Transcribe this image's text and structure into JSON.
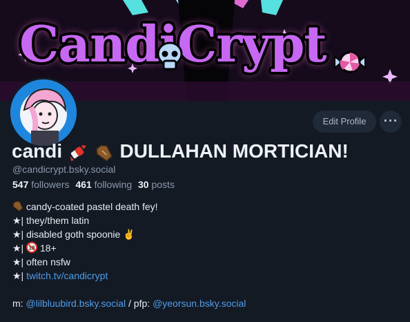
{
  "banner": {
    "title": "CandiCrypt"
  },
  "profile": {
    "display_name_prefix": "candi",
    "display_name_suffix": "DULLAHAN MORTICIAN!",
    "handle": "@candicrypt.bsky.social",
    "followers_count": "547",
    "followers_label": "followers",
    "following_count": "461",
    "following_label": "following",
    "posts_count": "30",
    "posts_label": "posts"
  },
  "buttons": {
    "edit_profile": "Edit Profile",
    "more": "···"
  },
  "bio": {
    "line1": "candy-coated pastel death fey!",
    "line2": "★| they/them latin",
    "line3_text": "★| disabled goth spoonie",
    "line4_prefix": "★|",
    "line4_text": "18+",
    "line5": "★| often nsfw",
    "line6_prefix": "★|",
    "line6_link": "twitch.tv/candicrypt",
    "credit_prefix": "m:",
    "credit_mention1": "@lilbluubird.bsky.social",
    "credit_mid": "/ pfp:",
    "credit_mention2": "@yeorsun.bsky.social"
  },
  "colors": {
    "background": "#141a24",
    "link": "#4f9dea",
    "muted": "#8b98aa",
    "banner_accent": "#c768f2"
  },
  "icons": [
    "candy-icon",
    "coffin-icon",
    "victory-hand-icon",
    "no-under-18-icon",
    "more-dots-icon"
  ]
}
